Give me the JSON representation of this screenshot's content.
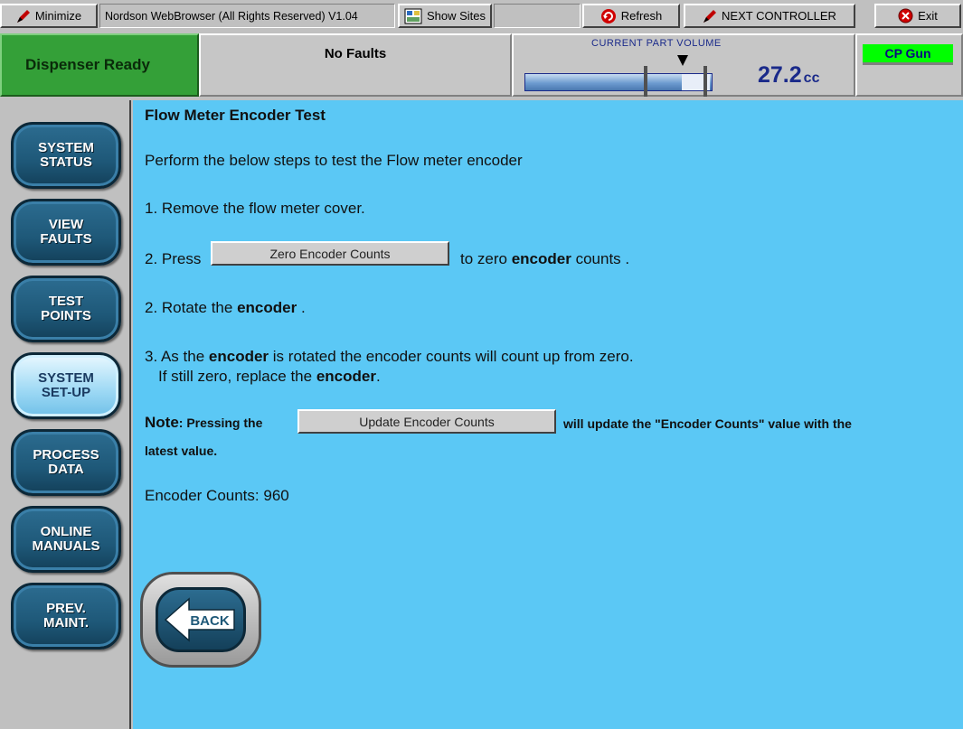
{
  "toolbar": {
    "minimize_label": "Minimize",
    "app_title": "Nordson WebBrowser (All Rights Reserved) V1.04",
    "show_sites_label": "Show Sites",
    "refresh_label": "Refresh",
    "next_controller_label": "NEXT CONTROLLER",
    "exit_label": "Exit"
  },
  "status": {
    "dispenser_state": "Dispenser Ready",
    "faults": "No Faults",
    "volume_label": "CURRENT PART VOLUME",
    "volume_value": "27.2",
    "volume_unit": "cc",
    "volume_marker_level": 0.84,
    "gun_name": "CP Gun"
  },
  "sidebar": {
    "items": [
      {
        "label": "SYSTEM\nSTATUS"
      },
      {
        "label": "VIEW\nFAULTS"
      },
      {
        "label": "TEST\nPOINTS"
      },
      {
        "label": "SYSTEM\nSET-UP",
        "active": true
      },
      {
        "label": "PROCESS\nDATA"
      },
      {
        "label": "ONLINE\nMANUALS"
      },
      {
        "label": "PREV.\nMAINT."
      }
    ]
  },
  "main": {
    "title": "Flow Meter Encoder Test",
    "intro": "Perform the below steps to test the Flow meter encoder",
    "step1": "1. Remove the flow meter cover.",
    "step2_prefix": "2. Press",
    "zero_button": "Zero Encoder Counts",
    "step2_suffix_a": "to zero",
    "step2_suffix_bold": "encoder",
    "step2_suffix_b": "counts .",
    "step3_prefix": "2. Rotate the",
    "step3_bold": "encoder",
    "step3_suffix": ".",
    "step4_a": "3. As the",
    "step4_bold": "encoder",
    "step4_b": "is rotated the encoder counts will count up from zero.",
    "step4_line2_a": "If still zero, replace the",
    "step4_line2_bold": "encoder",
    "step4_line2_b": ".",
    "note_label": "Note",
    "note_a": ": Pressing the",
    "update_button": "Update Encoder Counts",
    "note_b": "will update the \"Encoder Counts\" value with the",
    "note_line2": "latest value.",
    "encoder_counts_label": "Encoder Counts:",
    "encoder_counts_value": "960",
    "back_label": "BACK"
  },
  "colors": {
    "content_bg": "#5bc8f5",
    "ready_green": "#34a038",
    "gun_badge": "#00ff00",
    "nav_blue": "#1e5878"
  }
}
